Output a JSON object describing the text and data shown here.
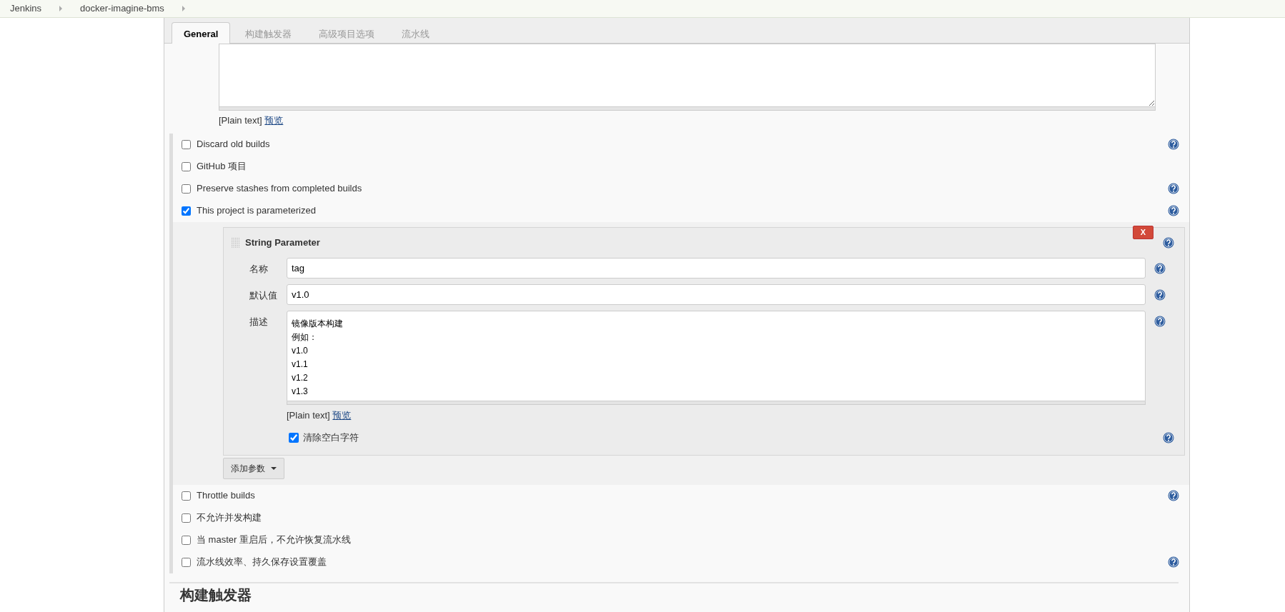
{
  "breadcrumbs": [
    "Jenkins",
    "docker-imagine-bms"
  ],
  "tabs": [
    {
      "label": "General",
      "selected": true
    },
    {
      "label": "构建触发器",
      "selected": false
    },
    {
      "label": "高级项目选项",
      "selected": false
    },
    {
      "label": "流水线",
      "selected": false
    }
  ],
  "description": {
    "note": "[Plain text]",
    "preview_link": "预览"
  },
  "options": [
    {
      "label": "Discard old builds",
      "checked": false,
      "help": true
    },
    {
      "label": "GitHub 项目",
      "checked": false,
      "help": false
    },
    {
      "label": "Preserve stashes from completed builds",
      "checked": false,
      "help": true
    },
    {
      "label": "This project is parameterized",
      "checked": true,
      "help": true
    }
  ],
  "parameters": {
    "items": [
      {
        "title": "String Parameter",
        "delete_label": "X",
        "fields": [
          {
            "kind": "input",
            "label": "名称",
            "value": "tag"
          },
          {
            "kind": "input",
            "label": "默认值",
            "value": "v1.0"
          },
          {
            "kind": "textarea",
            "label": "描述",
            "lines": [
              "镜像版本构建",
              "例如：",
              "v1.0",
              "v1.1",
              "v1.2",
              "v1.3"
            ]
          }
        ],
        "note": "[Plain text]",
        "preview_link": "预览",
        "trim": {
          "label": "清除空白字符",
          "checked": true
        }
      }
    ],
    "add_button": "添加参数"
  },
  "options_after": [
    {
      "label": "Throttle builds",
      "checked": false,
      "help": true
    },
    {
      "label": "不允许并发构建",
      "checked": false,
      "help": false
    },
    {
      "label": "当 master 重启后，不允许恢复流水线",
      "checked": false,
      "help": false
    },
    {
      "label": "流水线效率、持久保存设置覆盖",
      "checked": false,
      "help": true
    }
  ],
  "section_heading": "构建触发器"
}
